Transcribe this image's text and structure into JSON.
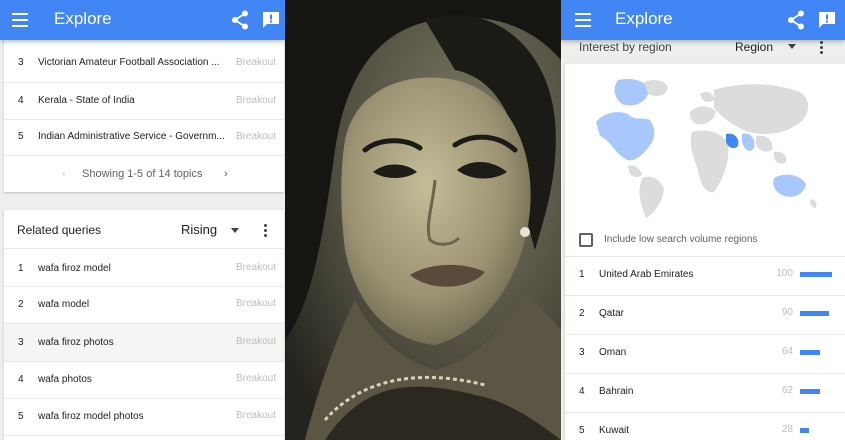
{
  "left_panel": {
    "appbar": {
      "title": "Explore"
    },
    "topics": {
      "rows": [
        {
          "rank": "3",
          "label": "Victorian Amateur Football Association ...",
          "value": "Breakout"
        },
        {
          "rank": "4",
          "label": "Kerala - State of India",
          "value": "Breakout"
        },
        {
          "rank": "5",
          "label": "Indian Administrative Service - Governm...",
          "value": "Breakout"
        }
      ],
      "pager": {
        "text": "Showing 1-5 of 14 topics",
        "prev": "‹",
        "next": "›"
      }
    },
    "related_queries": {
      "title": "Related queries",
      "filter": "Rising",
      "rows": [
        {
          "rank": "1",
          "label": "wafa firoz model",
          "value": "Breakout"
        },
        {
          "rank": "2",
          "label": "wafa model",
          "value": "Breakout"
        },
        {
          "rank": "3",
          "label": "wafa firoz photos",
          "value": "Breakout"
        },
        {
          "rank": "4",
          "label": "wafa photos",
          "value": "Breakout"
        },
        {
          "rank": "5",
          "label": "wafa firoz model photos",
          "value": "Breakout"
        }
      ]
    }
  },
  "right_panel": {
    "appbar": {
      "title": "Explore"
    },
    "region": {
      "title": "Interest by region",
      "filter": "Region",
      "checkbox_label": "Include low search volume regions",
      "checkbox_checked": false,
      "rows": [
        {
          "rank": "1",
          "label": "United Arab Emirates",
          "value": "100",
          "level": 1.0
        },
        {
          "rank": "2",
          "label": "Qatar",
          "value": "90",
          "level": 0.9
        },
        {
          "rank": "3",
          "label": "Oman",
          "value": "64",
          "level": 0.64
        },
        {
          "rank": "4",
          "label": "Bahrain",
          "value": "62",
          "level": 0.62
        },
        {
          "rank": "5",
          "label": "Kuwait",
          "value": "28",
          "level": 0.28
        }
      ]
    },
    "colors": {
      "accent": "#4285f4",
      "map_land": "#dcdcdc",
      "map_highlight": "#a8c7fa"
    }
  }
}
